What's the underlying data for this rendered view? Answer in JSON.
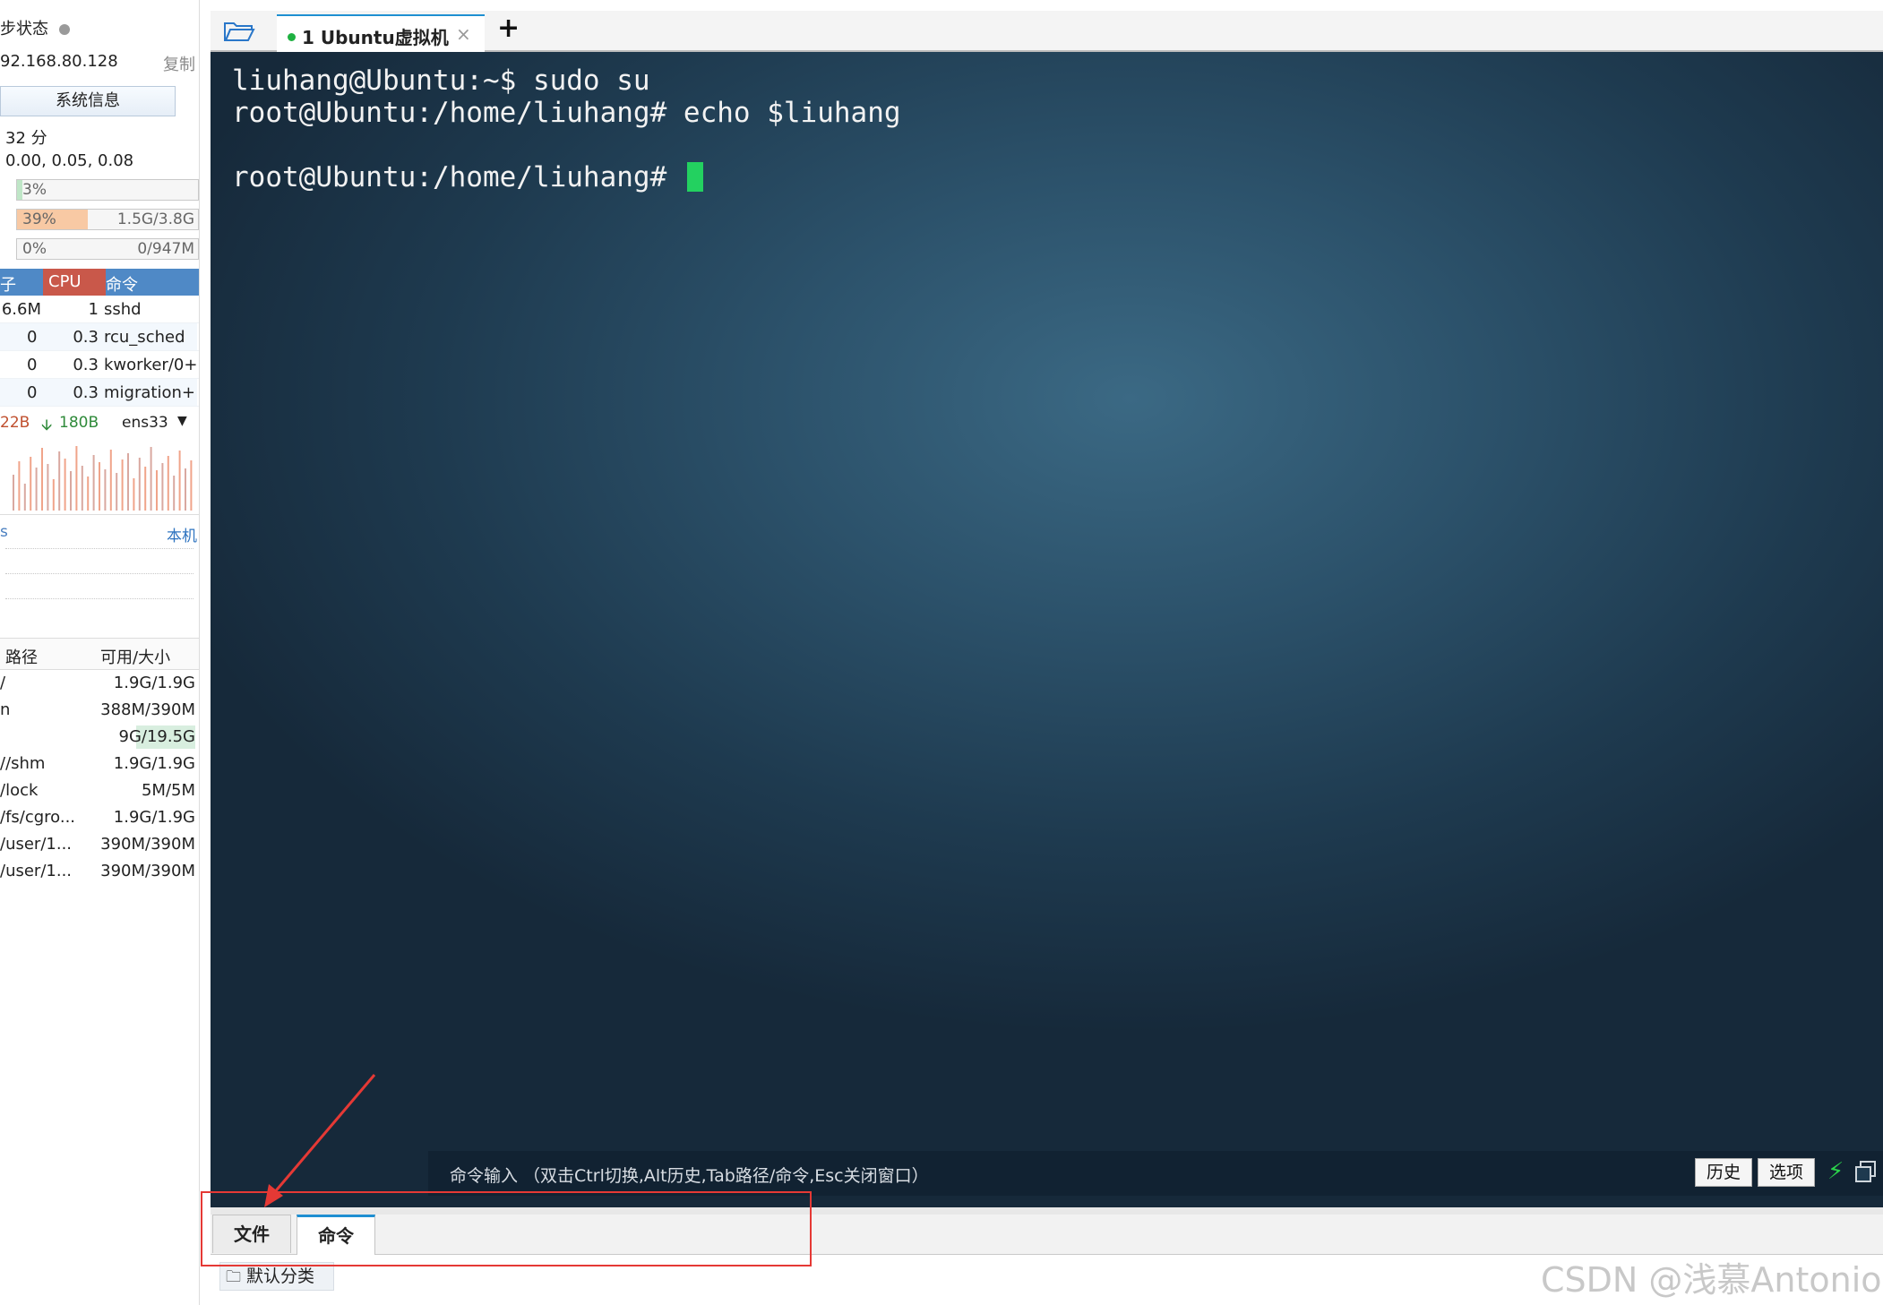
{
  "sidebar": {
    "sync_status": "步状态",
    "ip": "92.168.80.128",
    "copy_label": "复制",
    "sys_info_button": "系统信息",
    "uptime": "32 分",
    "load": "0.00, 0.05, 0.08",
    "cpu_bar": {
      "left": "3%",
      "right": "",
      "fill_pct": 3
    },
    "mem_bar": {
      "left": "39%",
      "right": "1.5G/3.8G",
      "fill_pct": 39
    },
    "swap_bar": {
      "left": "0%",
      "right": "0/947M",
      "fill_pct": 0
    },
    "row_prefix_cpu": "0",
    "row_prefix_mem": "",
    "row_prefix_swap": "",
    "process_headers": {
      "mem": "子",
      "cpu": "CPU",
      "cmd": "命令"
    },
    "processes": [
      {
        "mem": "6.6M",
        "cpu": "1",
        "cmd": "sshd"
      },
      {
        "mem": "0",
        "cpu": "0.3",
        "cmd": "rcu_sched"
      },
      {
        "mem": "0",
        "cpu": "0.3",
        "cmd": "kworker/0+"
      },
      {
        "mem": "0",
        "cpu": "0.3",
        "cmd": "migration+"
      }
    ],
    "net": {
      "up": "22B",
      "down": "180B",
      "iface": "ens33"
    },
    "net_foot": {
      "left": "s",
      "right": "本机"
    },
    "disk_headers": {
      "path": "路径",
      "size": "可用/大小"
    },
    "disks": [
      {
        "path": "/",
        "size": "1.9G/1.9G"
      },
      {
        "path": "n",
        "size": "388M/390M"
      },
      {
        "path": "",
        "size": "9G/19.5G"
      },
      {
        "path": "//shm",
        "size": "1.9G/1.9G"
      },
      {
        "path": "/lock",
        "size": "5M/5M"
      },
      {
        "path": "/fs/cgro...",
        "size": "1.9G/1.9G"
      },
      {
        "path": "/user/1...",
        "size": "390M/390M"
      },
      {
        "path": "/user/1...",
        "size": "390M/390M"
      }
    ]
  },
  "tabs": {
    "active_label": "1 Ubuntu虚拟机",
    "close": "×",
    "add": "+"
  },
  "terminal": {
    "lines": [
      "liuhang@Ubuntu:~$ sudo su",
      "root@Ubuntu:/home/liuhang# echo $liuhang",
      "",
      "root@Ubuntu:/home/liuhang# "
    ]
  },
  "command_bar": {
    "hint": "命令输入 （双击Ctrl切换,Alt历史,Tab路径/命令,Esc关闭窗口）",
    "history_button": "历史",
    "options_button": "选项",
    "bolt": "⚡"
  },
  "bottom_tabs": {
    "files": "文件",
    "commands": "命令"
  },
  "bottom": {
    "category": "默认分类"
  },
  "watermark": "CSDN @浅慕Antonio",
  "colors": {
    "accent": "#1e8fd1",
    "cursor": "#23d160",
    "annotation": "#e53935"
  }
}
